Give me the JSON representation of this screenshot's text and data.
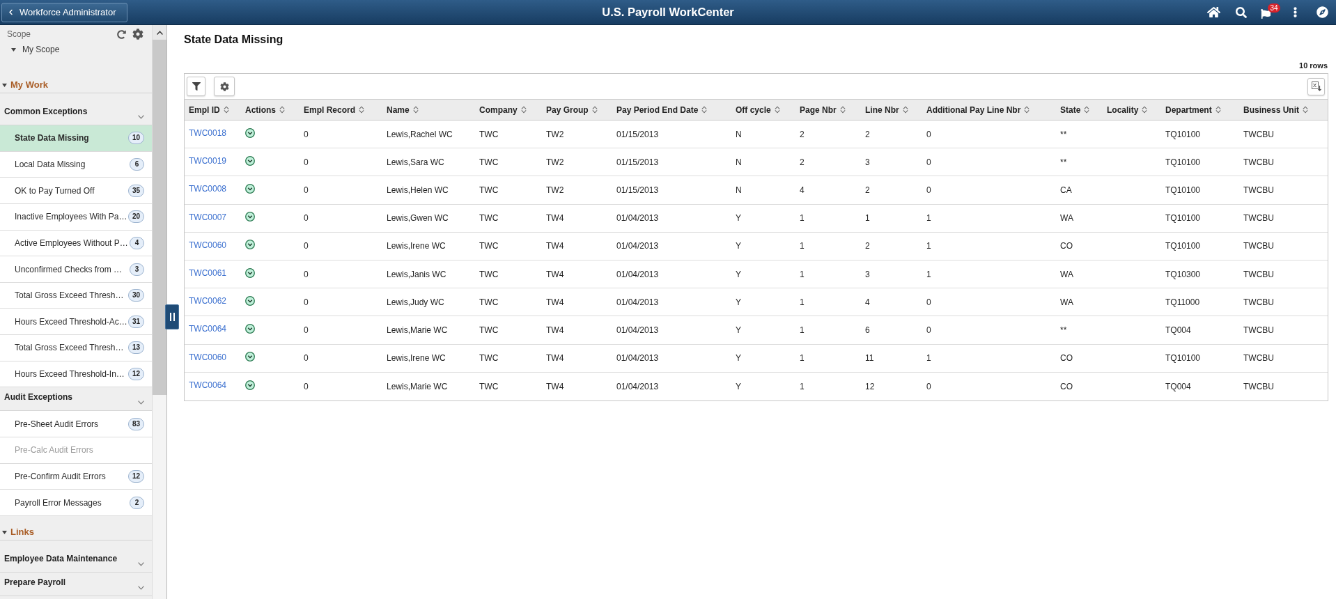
{
  "header": {
    "back_button": "Workforce Administrator",
    "title": "U.S. Payroll WorkCenter",
    "notification_count": "34"
  },
  "sidebar": {
    "scope": {
      "label": "Scope",
      "item": "My Scope"
    },
    "sections": [
      {
        "title": "My Work",
        "groups": [
          {
            "title": "Common Exceptions",
            "items": [
              {
                "label": "State Data Missing",
                "count": "10",
                "selected": true,
                "disabled": false
              },
              {
                "label": "Local Data Missing",
                "count": "6",
                "selected": false,
                "disabled": false
              },
              {
                "label": "OK to Pay Turned Off",
                "count": "35",
                "selected": false,
                "disabled": false
              },
              {
                "label": "Inactive Employees With Pa…",
                "count": "20",
                "selected": false,
                "disabled": false
              },
              {
                "label": "Active Employees Without P…",
                "count": "4",
                "selected": false,
                "disabled": false
              },
              {
                "label": "Unconfirmed Checks from …",
                "count": "3",
                "selected": false,
                "disabled": false
              },
              {
                "label": "Total Gross Exceed Thresh…",
                "count": "30",
                "selected": false,
                "disabled": false
              },
              {
                "label": "Hours Exceed Threshold-Ac…",
                "count": "31",
                "selected": false,
                "disabled": false
              },
              {
                "label": "Total Gross Exceed Thresh…",
                "count": "13",
                "selected": false,
                "disabled": false
              },
              {
                "label": "Hours Exceed Threshold-In…",
                "count": "12",
                "selected": false,
                "disabled": false
              }
            ]
          },
          {
            "title": "Audit Exceptions",
            "items": [
              {
                "label": "Pre-Sheet Audit Errors",
                "count": "83",
                "selected": false,
                "disabled": false
              },
              {
                "label": "Pre-Calc Audit Errors",
                "selected": false,
                "disabled": true
              },
              {
                "label": "Pre-Confirm Audit Errors",
                "count": "12",
                "selected": false,
                "disabled": false
              },
              {
                "label": "Payroll Error Messages",
                "count": "2",
                "selected": false,
                "disabled": false
              }
            ]
          }
        ]
      },
      {
        "title": "Links",
        "groups": [
          {
            "title": "Employee Data Maintenance"
          },
          {
            "title": "Prepare Payroll"
          }
        ]
      }
    ]
  },
  "main": {
    "title": "State Data Missing",
    "row_count": "10 rows",
    "table": {
      "columns": [
        {
          "label": "Empl ID",
          "kind": "link"
        },
        {
          "label": "Actions",
          "kind": "menu"
        },
        {
          "label": "Empl Record",
          "kind": "text"
        },
        {
          "label": "Name",
          "kind": "text"
        },
        {
          "label": "Company",
          "kind": "text"
        },
        {
          "label": "Pay Group",
          "kind": "text"
        },
        {
          "label": "Pay Period End Date",
          "kind": "text"
        },
        {
          "label": "Off cycle",
          "kind": "text"
        },
        {
          "label": "Page Nbr",
          "kind": "text"
        },
        {
          "label": "Line Nbr",
          "kind": "text"
        },
        {
          "label": "Additional Pay Line Nbr",
          "kind": "text"
        },
        {
          "label": "State",
          "kind": "text"
        },
        {
          "label": "Locality",
          "kind": "text"
        },
        {
          "label": "Department",
          "kind": "text"
        },
        {
          "label": "Business Unit",
          "kind": "text"
        }
      ],
      "rows": [
        {
          "empl_id": "TWC0018",
          "empl_record": "0",
          "name": "Lewis,Rachel WC",
          "company": "TWC",
          "pay_group": "TW2",
          "pay_period_end_date": "01/15/2013",
          "off_cycle": "N",
          "page_nbr": "2",
          "line_nbr": "2",
          "additional_pay_line_nbr": "0",
          "state": "**",
          "department": "TQ10100",
          "business_unit": "TWCBU"
        },
        {
          "empl_id": "TWC0019",
          "empl_record": "0",
          "name": "Lewis,Sara WC",
          "company": "TWC",
          "pay_group": "TW2",
          "pay_period_end_date": "01/15/2013",
          "off_cycle": "N",
          "page_nbr": "2",
          "line_nbr": "3",
          "additional_pay_line_nbr": "0",
          "state": "**",
          "department": "TQ10100",
          "business_unit": "TWCBU"
        },
        {
          "empl_id": "TWC0008",
          "empl_record": "0",
          "name": "Lewis,Helen WC",
          "company": "TWC",
          "pay_group": "TW2",
          "pay_period_end_date": "01/15/2013",
          "off_cycle": "N",
          "page_nbr": "4",
          "line_nbr": "2",
          "additional_pay_line_nbr": "0",
          "state": "CA",
          "department": "TQ10100",
          "business_unit": "TWCBU"
        },
        {
          "empl_id": "TWC0007",
          "empl_record": "0",
          "name": "Lewis,Gwen WC",
          "company": "TWC",
          "pay_group": "TW4",
          "pay_period_end_date": "01/04/2013",
          "off_cycle": "Y",
          "page_nbr": "1",
          "line_nbr": "1",
          "additional_pay_line_nbr": "1",
          "state": "WA",
          "department": "TQ10100",
          "business_unit": "TWCBU"
        },
        {
          "empl_id": "TWC0060",
          "empl_record": "0",
          "name": "Lewis,Irene WC",
          "company": "TWC",
          "pay_group": "TW4",
          "pay_period_end_date": "01/04/2013",
          "off_cycle": "Y",
          "page_nbr": "1",
          "line_nbr": "2",
          "additional_pay_line_nbr": "1",
          "state": "CO",
          "department": "TQ10100",
          "business_unit": "TWCBU"
        },
        {
          "empl_id": "TWC0061",
          "empl_record": "0",
          "name": "Lewis,Janis WC",
          "company": "TWC",
          "pay_group": "TW4",
          "pay_period_end_date": "01/04/2013",
          "off_cycle": "Y",
          "page_nbr": "1",
          "line_nbr": "3",
          "additional_pay_line_nbr": "1",
          "state": "WA",
          "department": "TQ10300",
          "business_unit": "TWCBU"
        },
        {
          "empl_id": "TWC0062",
          "empl_record": "0",
          "name": "Lewis,Judy WC",
          "company": "TWC",
          "pay_group": "TW4",
          "pay_period_end_date": "01/04/2013",
          "off_cycle": "Y",
          "page_nbr": "1",
          "line_nbr": "4",
          "additional_pay_line_nbr": "0",
          "state": "WA",
          "department": "TQ11000",
          "business_unit": "TWCBU"
        },
        {
          "empl_id": "TWC0064",
          "empl_record": "0",
          "name": "Lewis,Marie WC",
          "company": "TWC",
          "pay_group": "TW4",
          "pay_period_end_date": "01/04/2013",
          "off_cycle": "Y",
          "page_nbr": "1",
          "line_nbr": "6",
          "additional_pay_line_nbr": "0",
          "state": "**",
          "department": "TQ004",
          "business_unit": "TWCBU"
        },
        {
          "empl_id": "TWC0060",
          "empl_record": "0",
          "name": "Lewis,Irene WC",
          "company": "TWC",
          "pay_group": "TW4",
          "pay_period_end_date": "01/04/2013",
          "off_cycle": "Y",
          "page_nbr": "1",
          "line_nbr": "11",
          "additional_pay_line_nbr": "1",
          "state": "CO",
          "department": "TQ10100",
          "business_unit": "TWCBU"
        },
        {
          "empl_id": "TWC0064",
          "empl_record": "0",
          "name": "Lewis,Marie WC",
          "company": "TWC",
          "pay_group": "TW4",
          "pay_period_end_date": "01/04/2013",
          "off_cycle": "Y",
          "page_nbr": "1",
          "line_nbr": "12",
          "additional_pay_line_nbr": "0",
          "state": "CO",
          "department": "TQ004",
          "business_unit": "TWCBU"
        }
      ]
    }
  }
}
